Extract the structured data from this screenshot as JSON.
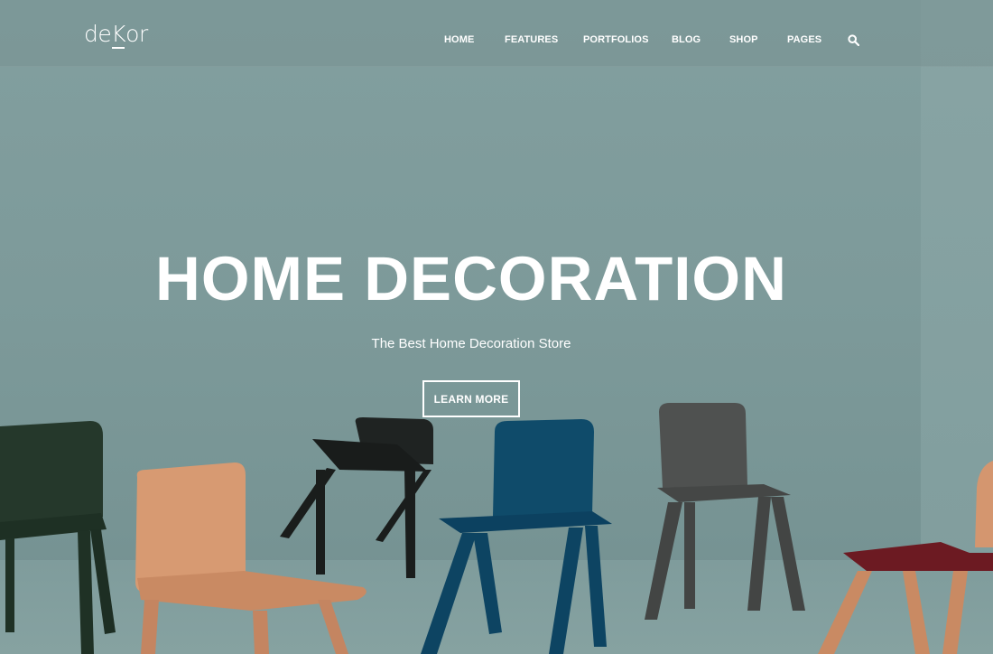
{
  "header": {
    "logo": {
      "pre": "de",
      "mid": "K",
      "post": "or"
    },
    "nav": [
      {
        "label": "HOME"
      },
      {
        "label": "FEATURES"
      },
      {
        "label": "PORTFOLIOS"
      },
      {
        "label": "BLOG"
      },
      {
        "label": "SHOP"
      },
      {
        "label": "PAGES"
      }
    ],
    "search_icon": "search-icon"
  },
  "hero": {
    "title": "HOME DECORATION",
    "subtitle": "The Best Home Decoration Store",
    "cta_label": "LEARN MORE",
    "background": "photo of colorful wooden chairs against a teal wall"
  },
  "colors": {
    "wall": "#7f9c9c",
    "text": "#ffffff",
    "chair_green": "#25382b",
    "chair_wood": "#d79a72",
    "chair_black": "#1f2322",
    "chair_blue": "#0f4b6a",
    "chair_gray": "#4f5150",
    "chair_burgundy": "#6c1a22"
  }
}
